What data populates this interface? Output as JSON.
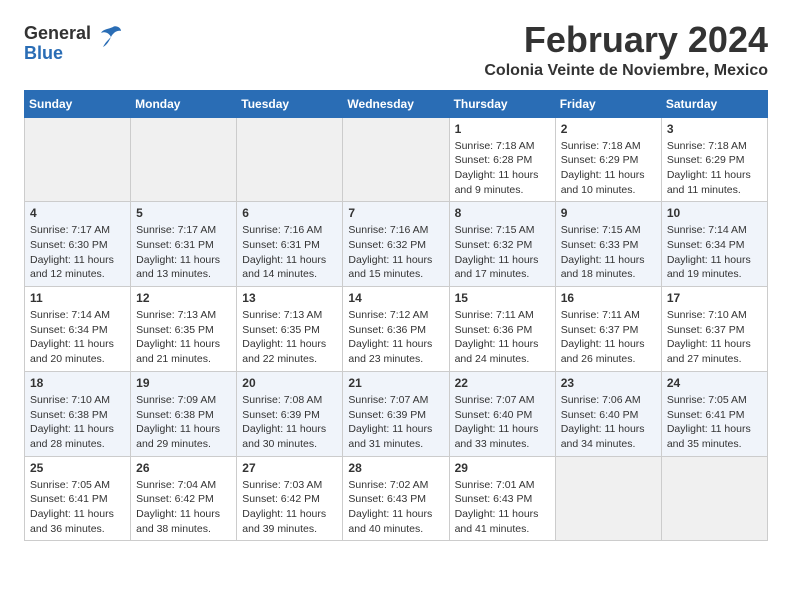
{
  "app": {
    "logo_general": "General",
    "logo_blue": "Blue"
  },
  "header": {
    "month": "February 2024",
    "location": "Colonia Veinte de Noviembre, Mexico"
  },
  "calendar": {
    "days_of_week": [
      "Sunday",
      "Monday",
      "Tuesday",
      "Wednesday",
      "Thursday",
      "Friday",
      "Saturday"
    ],
    "weeks": [
      [
        {
          "day": "",
          "info": ""
        },
        {
          "day": "",
          "info": ""
        },
        {
          "day": "",
          "info": ""
        },
        {
          "day": "",
          "info": ""
        },
        {
          "day": "1",
          "info": "Sunrise: 7:18 AM\nSunset: 6:28 PM\nDaylight: 11 hours\nand 9 minutes."
        },
        {
          "day": "2",
          "info": "Sunrise: 7:18 AM\nSunset: 6:29 PM\nDaylight: 11 hours\nand 10 minutes."
        },
        {
          "day": "3",
          "info": "Sunrise: 7:18 AM\nSunset: 6:29 PM\nDaylight: 11 hours\nand 11 minutes."
        }
      ],
      [
        {
          "day": "4",
          "info": "Sunrise: 7:17 AM\nSunset: 6:30 PM\nDaylight: 11 hours\nand 12 minutes."
        },
        {
          "day": "5",
          "info": "Sunrise: 7:17 AM\nSunset: 6:31 PM\nDaylight: 11 hours\nand 13 minutes."
        },
        {
          "day": "6",
          "info": "Sunrise: 7:16 AM\nSunset: 6:31 PM\nDaylight: 11 hours\nand 14 minutes."
        },
        {
          "day": "7",
          "info": "Sunrise: 7:16 AM\nSunset: 6:32 PM\nDaylight: 11 hours\nand 15 minutes."
        },
        {
          "day": "8",
          "info": "Sunrise: 7:15 AM\nSunset: 6:32 PM\nDaylight: 11 hours\nand 17 minutes."
        },
        {
          "day": "9",
          "info": "Sunrise: 7:15 AM\nSunset: 6:33 PM\nDaylight: 11 hours\nand 18 minutes."
        },
        {
          "day": "10",
          "info": "Sunrise: 7:14 AM\nSunset: 6:34 PM\nDaylight: 11 hours\nand 19 minutes."
        }
      ],
      [
        {
          "day": "11",
          "info": "Sunrise: 7:14 AM\nSunset: 6:34 PM\nDaylight: 11 hours\nand 20 minutes."
        },
        {
          "day": "12",
          "info": "Sunrise: 7:13 AM\nSunset: 6:35 PM\nDaylight: 11 hours\nand 21 minutes."
        },
        {
          "day": "13",
          "info": "Sunrise: 7:13 AM\nSunset: 6:35 PM\nDaylight: 11 hours\nand 22 minutes."
        },
        {
          "day": "14",
          "info": "Sunrise: 7:12 AM\nSunset: 6:36 PM\nDaylight: 11 hours\nand 23 minutes."
        },
        {
          "day": "15",
          "info": "Sunrise: 7:11 AM\nSunset: 6:36 PM\nDaylight: 11 hours\nand 24 minutes."
        },
        {
          "day": "16",
          "info": "Sunrise: 7:11 AM\nSunset: 6:37 PM\nDaylight: 11 hours\nand 26 minutes."
        },
        {
          "day": "17",
          "info": "Sunrise: 7:10 AM\nSunset: 6:37 PM\nDaylight: 11 hours\nand 27 minutes."
        }
      ],
      [
        {
          "day": "18",
          "info": "Sunrise: 7:10 AM\nSunset: 6:38 PM\nDaylight: 11 hours\nand 28 minutes."
        },
        {
          "day": "19",
          "info": "Sunrise: 7:09 AM\nSunset: 6:38 PM\nDaylight: 11 hours\nand 29 minutes."
        },
        {
          "day": "20",
          "info": "Sunrise: 7:08 AM\nSunset: 6:39 PM\nDaylight: 11 hours\nand 30 minutes."
        },
        {
          "day": "21",
          "info": "Sunrise: 7:07 AM\nSunset: 6:39 PM\nDaylight: 11 hours\nand 31 minutes."
        },
        {
          "day": "22",
          "info": "Sunrise: 7:07 AM\nSunset: 6:40 PM\nDaylight: 11 hours\nand 33 minutes."
        },
        {
          "day": "23",
          "info": "Sunrise: 7:06 AM\nSunset: 6:40 PM\nDaylight: 11 hours\nand 34 minutes."
        },
        {
          "day": "24",
          "info": "Sunrise: 7:05 AM\nSunset: 6:41 PM\nDaylight: 11 hours\nand 35 minutes."
        }
      ],
      [
        {
          "day": "25",
          "info": "Sunrise: 7:05 AM\nSunset: 6:41 PM\nDaylight: 11 hours\nand 36 minutes."
        },
        {
          "day": "26",
          "info": "Sunrise: 7:04 AM\nSunset: 6:42 PM\nDaylight: 11 hours\nand 38 minutes."
        },
        {
          "day": "27",
          "info": "Sunrise: 7:03 AM\nSunset: 6:42 PM\nDaylight: 11 hours\nand 39 minutes."
        },
        {
          "day": "28",
          "info": "Sunrise: 7:02 AM\nSunset: 6:43 PM\nDaylight: 11 hours\nand 40 minutes."
        },
        {
          "day": "29",
          "info": "Sunrise: 7:01 AM\nSunset: 6:43 PM\nDaylight: 11 hours\nand 41 minutes."
        },
        {
          "day": "",
          "info": ""
        },
        {
          "day": "",
          "info": ""
        }
      ]
    ]
  }
}
